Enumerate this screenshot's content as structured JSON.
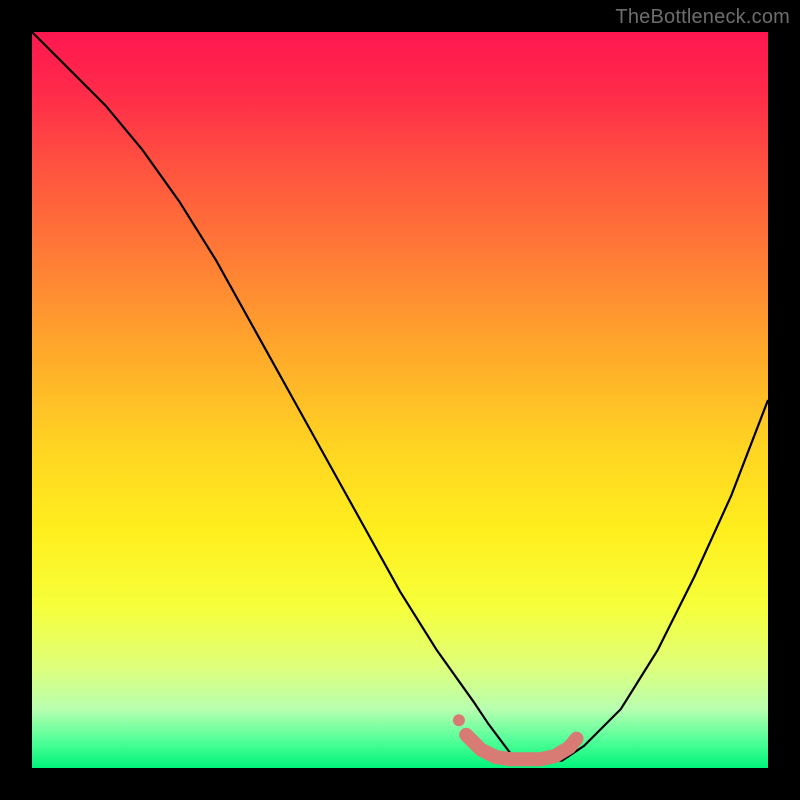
{
  "watermark": "TheBottleneck.com",
  "colors": {
    "background": "#000000",
    "curve": "#000000",
    "marker": "#d97b75",
    "gradient_top": "#ff1750",
    "gradient_bottom": "#00f47a"
  },
  "chart_data": {
    "type": "line",
    "title": "",
    "xlabel": "",
    "ylabel": "",
    "xlim": [
      0,
      100
    ],
    "ylim": [
      0,
      100
    ],
    "grid": false,
    "legend": false,
    "note": "Values are approximate readings from pixel positions; y is percentage height from bottom.",
    "series": [
      {
        "name": "bottleneck-curve",
        "x": [
          0,
          5,
          10,
          15,
          20,
          25,
          30,
          35,
          40,
          45,
          50,
          55,
          60,
          62,
          65,
          68,
          70,
          72,
          75,
          80,
          85,
          90,
          95,
          100
        ],
        "y": [
          100,
          95,
          90,
          84,
          77,
          69,
          60,
          51,
          42,
          33,
          24,
          16,
          9,
          6,
          2,
          1,
          1,
          1,
          3,
          8,
          16,
          26,
          37,
          50
        ]
      }
    ],
    "markers": {
      "name": "highlighted-range",
      "style": "thick-dots",
      "x": [
        59,
        61,
        63,
        65,
        67,
        69,
        71,
        73,
        74
      ],
      "y": [
        4.5,
        2.5,
        1.5,
        1.2,
        1.2,
        1.2,
        1.6,
        2.8,
        4.0
      ]
    }
  }
}
